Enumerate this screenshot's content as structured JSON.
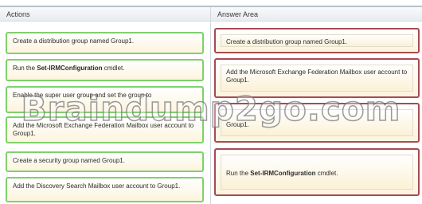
{
  "actions_panel": {
    "header": "Actions",
    "items": [
      {
        "text": "Create a distribution group named Group1."
      },
      {
        "prefix": "Run the ",
        "command": "Set-IRMConfiguration",
        "suffix": " cmdlet."
      },
      {
        "text": "Enable the super user group and set the group to"
      },
      {
        "text": "Add the Microsoft Exchange Federation Mailbox user account to Group1."
      },
      {
        "text": "Create a security group named Group1."
      },
      {
        "text": "Add the Discovery Search Mailbox user account to Group1."
      }
    ]
  },
  "answer_panel": {
    "header": "Answer Area",
    "items": [
      {
        "text": "Create a distribution group named Group1."
      },
      {
        "text": "Add the Microsoft Exchange Federation Mailbox user account to Group1."
      },
      {
        "text": "Group1."
      },
      {
        "prefix": "Run the ",
        "command": "Set-IRMConfiguration",
        "suffix": " cmdlet."
      }
    ]
  },
  "watermark": "Braindump2go.com",
  "colors": {
    "actions_border": "#7fd16b",
    "answer_border": "#a84a52",
    "card_fill": "#fdf4de"
  }
}
